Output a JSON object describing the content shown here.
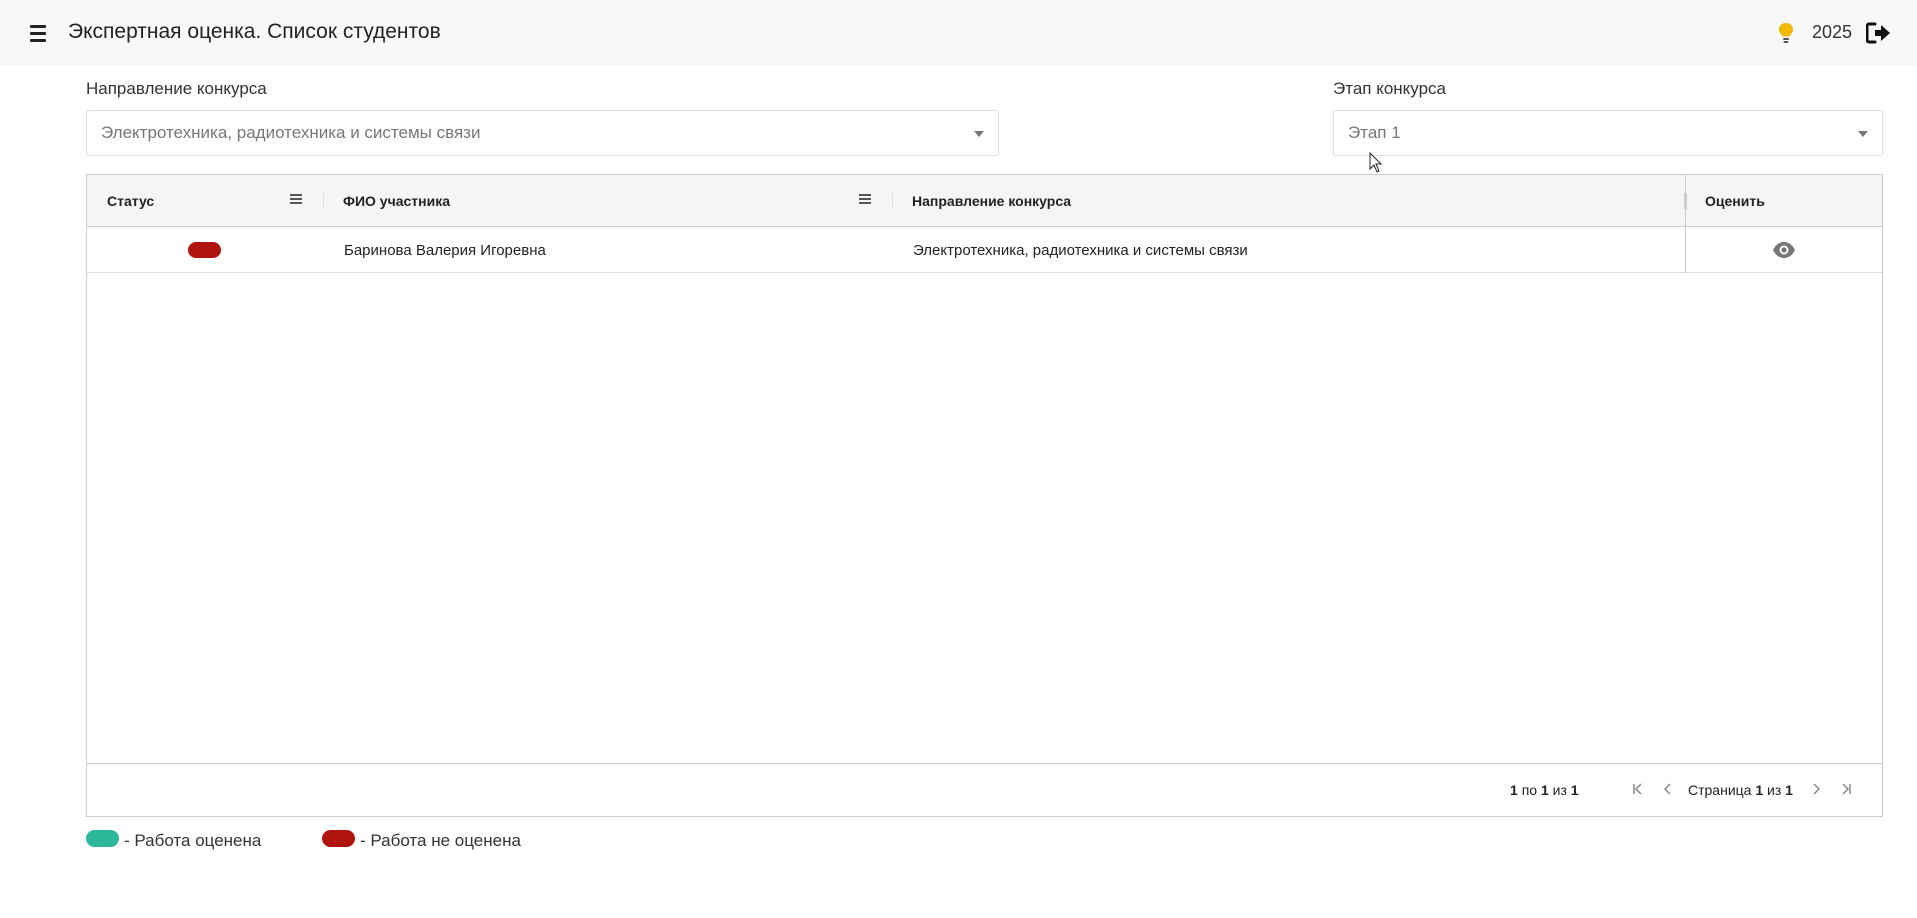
{
  "header": {
    "title": "Экспертная оценка. Список студентов",
    "year": "2025"
  },
  "filters": {
    "direction": {
      "label": "Направление конкурса",
      "value": "Электротехника, радиотехника и системы связи"
    },
    "stage": {
      "label": "Этап конкурса",
      "value": "Этап 1"
    }
  },
  "grid": {
    "columns": [
      "Статус",
      "ФИО участника",
      "Направление конкурса",
      "Оценить"
    ],
    "rows": [
      {
        "status": "not-rated",
        "name": "Баринова Валерия Игоревна",
        "direction": "Электротехника, радиотехника и системы связи"
      }
    ],
    "footer": {
      "range_from": "1",
      "range_sep1": "по",
      "range_to": "1",
      "range_sep2": "из",
      "range_total": "1",
      "page_label": "Страница",
      "page_current": "1",
      "page_sep": "из",
      "page_total": "1"
    }
  },
  "legend": {
    "rated": "- Работа оценена",
    "not_rated": "- Работа не оценена"
  },
  "colors": {
    "rated": "#2bb89a",
    "not_rated": "#b0140f",
    "bulb": "#f2b900"
  }
}
